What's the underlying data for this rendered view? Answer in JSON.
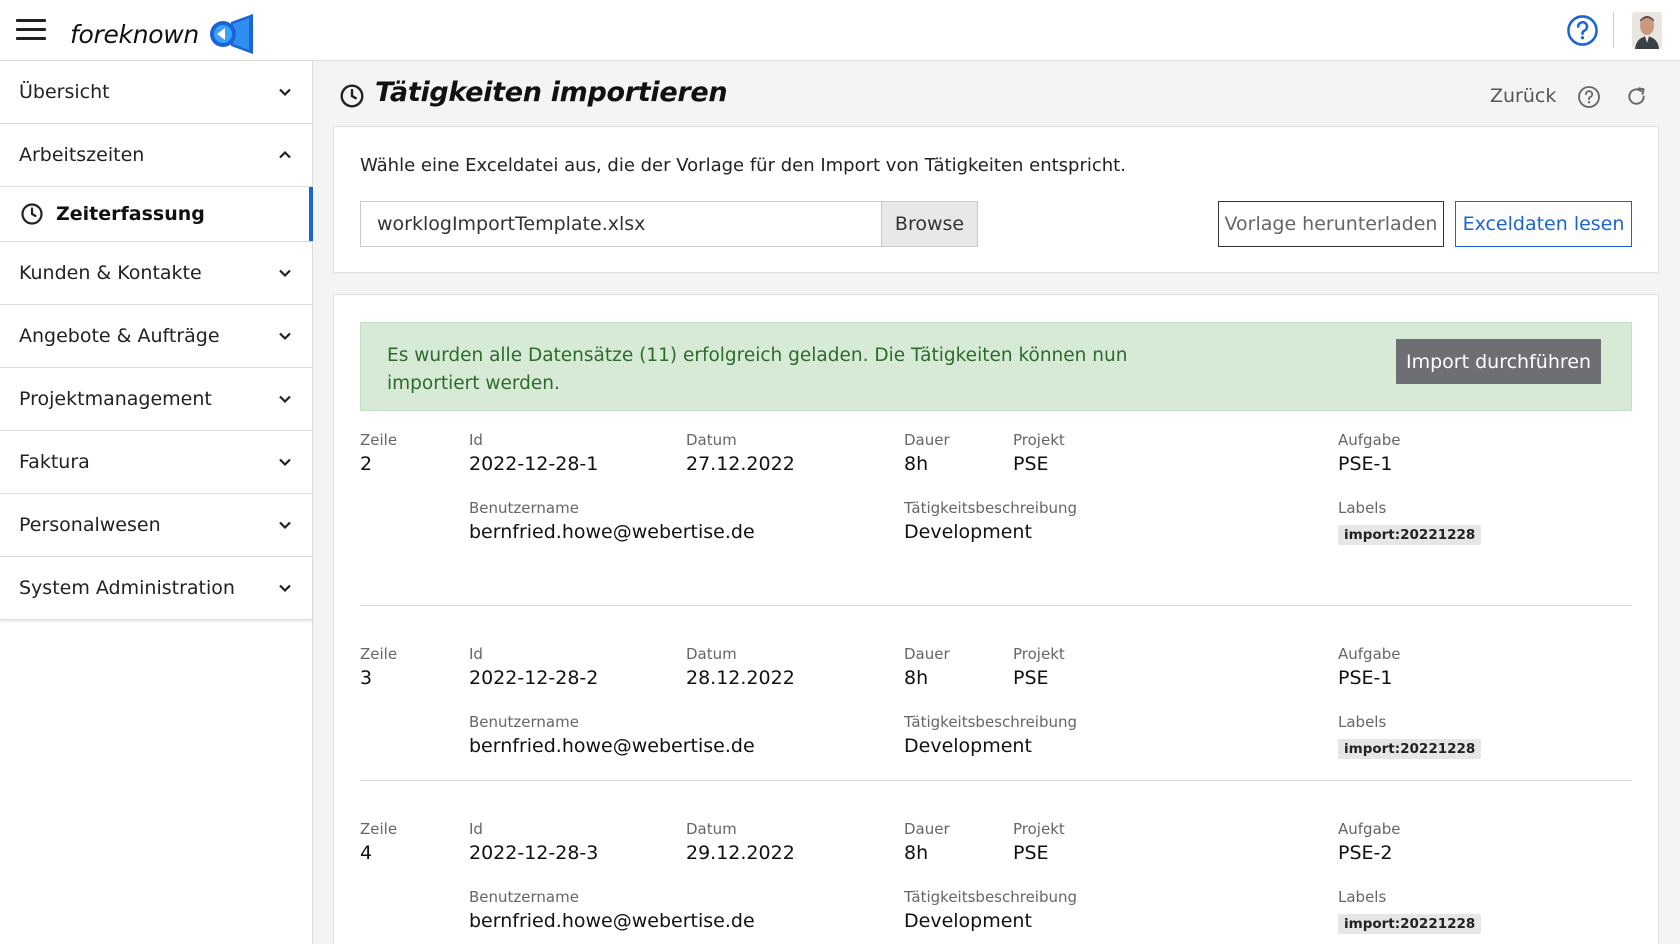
{
  "app": {
    "brand": "foreknown"
  },
  "colors": {
    "accent": "#1a64d8",
    "success_bg": "#d6ead6",
    "success_text": "#2d6a2d",
    "primary_btn": "#6d6f72"
  },
  "sidebar": {
    "items": [
      {
        "label": "Übersicht",
        "icon": "chevron-down-icon"
      },
      {
        "label": "Arbeitszeiten",
        "icon": "chevron-up-icon"
      },
      {
        "label": "Zeiterfassung",
        "icon": "clock-icon",
        "active": true
      },
      {
        "label": "Kunden & Kontakte",
        "icon": "chevron-down-icon"
      },
      {
        "label": "Angebote & Aufträge",
        "icon": "chevron-down-icon"
      },
      {
        "label": "Projektmanagement",
        "icon": "chevron-down-icon"
      },
      {
        "label": "Faktura",
        "icon": "chevron-down-icon"
      },
      {
        "label": "Personalwesen",
        "icon": "chevron-down-icon"
      },
      {
        "label": "System Administration",
        "icon": "chevron-down-icon"
      }
    ]
  },
  "page": {
    "title": "Tätigkeiten importieren",
    "back_label": "Zurück"
  },
  "upload": {
    "instruction": "Wähle eine Exceldatei aus, die der Vorlage für den Import von Tätigkeiten entspricht.",
    "file_value": "worklogImportTemplate.xlsx",
    "browse_label": "Browse",
    "download_template_label": "Vorlage herunterladen",
    "read_excel_label": "Exceldaten lesen"
  },
  "result": {
    "message": "Es wurden alle Datensätze (11) erfolgreich geladen. Die Tätigkeiten können nun importiert werden.",
    "import_label": "Import durchführen"
  },
  "labels": {
    "zeile": "Zeile",
    "id": "Id",
    "datum": "Datum",
    "dauer": "Dauer",
    "projekt": "Projekt",
    "aufgabe": "Aufgabe",
    "benutzername": "Benutzername",
    "beschreibung": "Tätigkeitsbeschreibung",
    "labels": "Labels"
  },
  "rows": [
    {
      "zeile": "2",
      "id": "2022-12-28-1",
      "datum": "27.12.2022",
      "dauer": "8h",
      "projekt": "PSE",
      "aufgabe": "PSE-1",
      "benutzername": "bernfried.howe@webertise.de",
      "beschreibung": "Development",
      "label": "import:20221228"
    },
    {
      "zeile": "3",
      "id": "2022-12-28-2",
      "datum": "28.12.2022",
      "dauer": "8h",
      "projekt": "PSE",
      "aufgabe": "PSE-1",
      "benutzername": "bernfried.howe@webertise.de",
      "beschreibung": "Development",
      "label": "import:20221228"
    },
    {
      "zeile": "4",
      "id": "2022-12-28-3",
      "datum": "29.12.2022",
      "dauer": "8h",
      "projekt": "PSE",
      "aufgabe": "PSE-2",
      "benutzername": "bernfried.howe@webertise.de",
      "beschreibung": "Development",
      "label": "import:20221228"
    }
  ]
}
